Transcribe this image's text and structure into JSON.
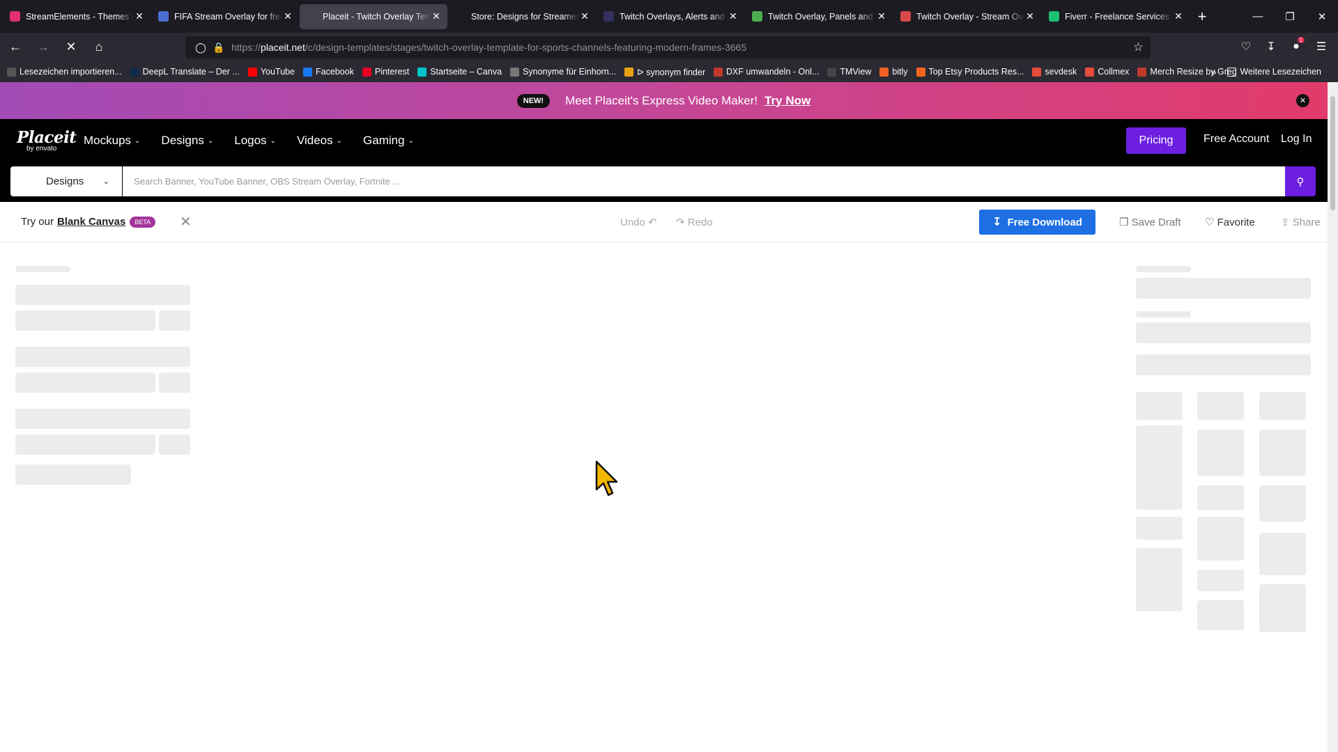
{
  "browser": {
    "tabs": [
      {
        "title": "StreamElements - Themes gallery",
        "color": "#e0316d",
        "active": false
      },
      {
        "title": "FIFA Stream Overlay for free, Download",
        "color": "#4a6fd1",
        "active": false
      },
      {
        "title": "Placeit - Twitch Overlay Template",
        "color": "#42414d",
        "active": true
      },
      {
        "title": "Store: Designs for Streamers and",
        "color": "#1c1b22",
        "active": false
      },
      {
        "title": "Twitch Overlays, Alerts and Graphics",
        "color": "#33315f",
        "active": false
      },
      {
        "title": "Twitch Overlay, Panels and YouTube",
        "color": "#4caf50",
        "active": false
      },
      {
        "title": "Twitch Overlay - Stream Overlays",
        "color": "#d84a4a",
        "active": false
      },
      {
        "title": "Fiverr - Freelance Services Marketplace",
        "color": "#1dbf73",
        "active": false
      }
    ],
    "url_prefix": "https://",
    "url_host": "placeit.net",
    "url_path": "/c/design-templates/stages/twitch-overlay-template-for-sports-channels-featuring-modern-frames-3665",
    "bookmarks": [
      {
        "label": "Lesezeichen importieren...",
        "color": "#555"
      },
      {
        "label": "DeepL Translate – Der ...",
        "color": "#0f2b46"
      },
      {
        "label": "YouTube",
        "color": "#ff0000"
      },
      {
        "label": "Facebook",
        "color": "#1877f2"
      },
      {
        "label": "Pinterest",
        "color": "#e60023"
      },
      {
        "label": "Startseite – Canva",
        "color": "#00c4cc"
      },
      {
        "label": "Synonyme für Einhorn...",
        "color": "#777"
      },
      {
        "label": "ᐅ synonym finder",
        "color": "#e8a317"
      },
      {
        "label": "DXF umwandeln - Onl...",
        "color": "#c0392b"
      },
      {
        "label": "TMView",
        "color": "#444"
      },
      {
        "label": "bitly",
        "color": "#ee6123"
      },
      {
        "label": "Top Etsy Products Res...",
        "color": "#f1641e"
      },
      {
        "label": "sevdesk",
        "color": "#e74c3c"
      },
      {
        "label": "Collmex",
        "color": "#e74c3c"
      },
      {
        "label": "Merch Resize by Greg",
        "color": "#c0392b"
      }
    ],
    "more_bookmarks": "Weitere Lesezeichen"
  },
  "promo": {
    "badge": "NEW!",
    "message": "Meet Placeit's Express Video Maker!",
    "cta": "Try Now"
  },
  "header": {
    "logo_main": "Placeit",
    "logo_sub": "by envato",
    "menu": [
      "Mockups",
      "Designs",
      "Logos",
      "Videos",
      "Gaming"
    ],
    "pricing": "Pricing",
    "free_account": "Free Account",
    "login": "Log In"
  },
  "search": {
    "category": "Designs",
    "placeholder": "Search Banner, YouTube Banner, OBS Stream Overlay, Fortnite ..."
  },
  "toolbar": {
    "try_text": "Try our",
    "blank_canvas": "Blank Canvas",
    "beta": "BETA",
    "undo": "Undo",
    "redo": "Redo",
    "free_download": "Free Download",
    "save_draft": "Save Draft",
    "favorite": "Favorite",
    "share": "Share"
  },
  "colors": {
    "accent_purple": "#6c1fe0",
    "download_blue": "#1d6fe3",
    "promo_start": "#a24bb6",
    "promo_end": "#e23a6a"
  }
}
